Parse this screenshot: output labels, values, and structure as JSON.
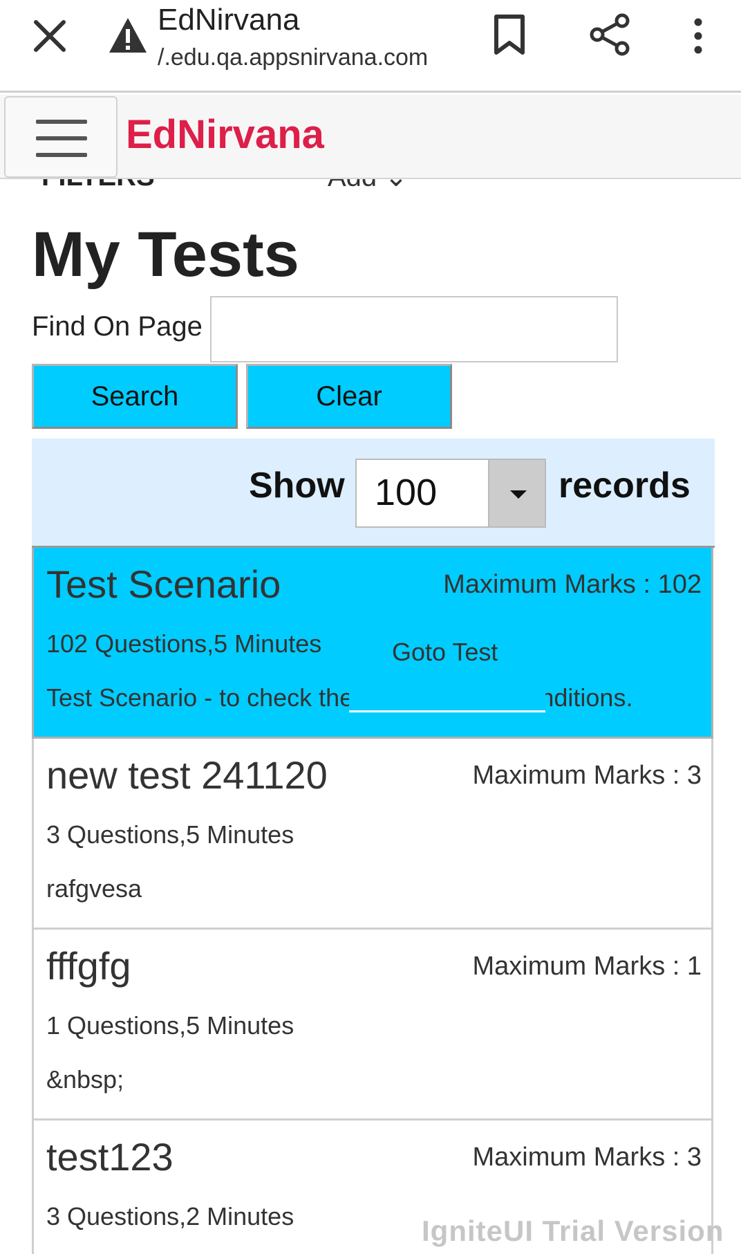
{
  "browser": {
    "title": "EdNirvana",
    "url": "/.edu.qa.appsnirvana.com"
  },
  "app": {
    "brand": "EdNirvana",
    "filters_label": "FILTERS",
    "add_label": "Add"
  },
  "page": {
    "title": "My Tests",
    "find_label": "Find On Page",
    "find_value": "",
    "search_button": "Search",
    "clear_button": "Clear"
  },
  "records": {
    "show_label": "Show",
    "selected": "100",
    "suffix": "records"
  },
  "tests": [
    {
      "name": "Test Scenario",
      "max_marks": "Maximum Marks : 102",
      "meta": "102 Questions,5 Minutes",
      "desc": "Test Scenario - to check the Duration field conditions.",
      "goto": "Goto Test"
    },
    {
      "name": "new test 241120",
      "max_marks": "Maximum Marks : 3",
      "meta": "3 Questions,5 Minutes",
      "desc": "rafgvesa"
    },
    {
      "name": "fffgfg",
      "max_marks": "Maximum Marks : 1",
      "meta": "1 Questions,5 Minutes",
      "desc": "&nbsp;"
    },
    {
      "name": "test123",
      "max_marks": "Maximum Marks : 3",
      "meta": "3 Questions,2 Minutes",
      "desc": ""
    }
  ],
  "watermark": "IgniteUI Trial Version",
  "colors": {
    "brand": "#dd1f4a",
    "accent": "#00ccff",
    "toolbar_bg": "#ddefff"
  }
}
